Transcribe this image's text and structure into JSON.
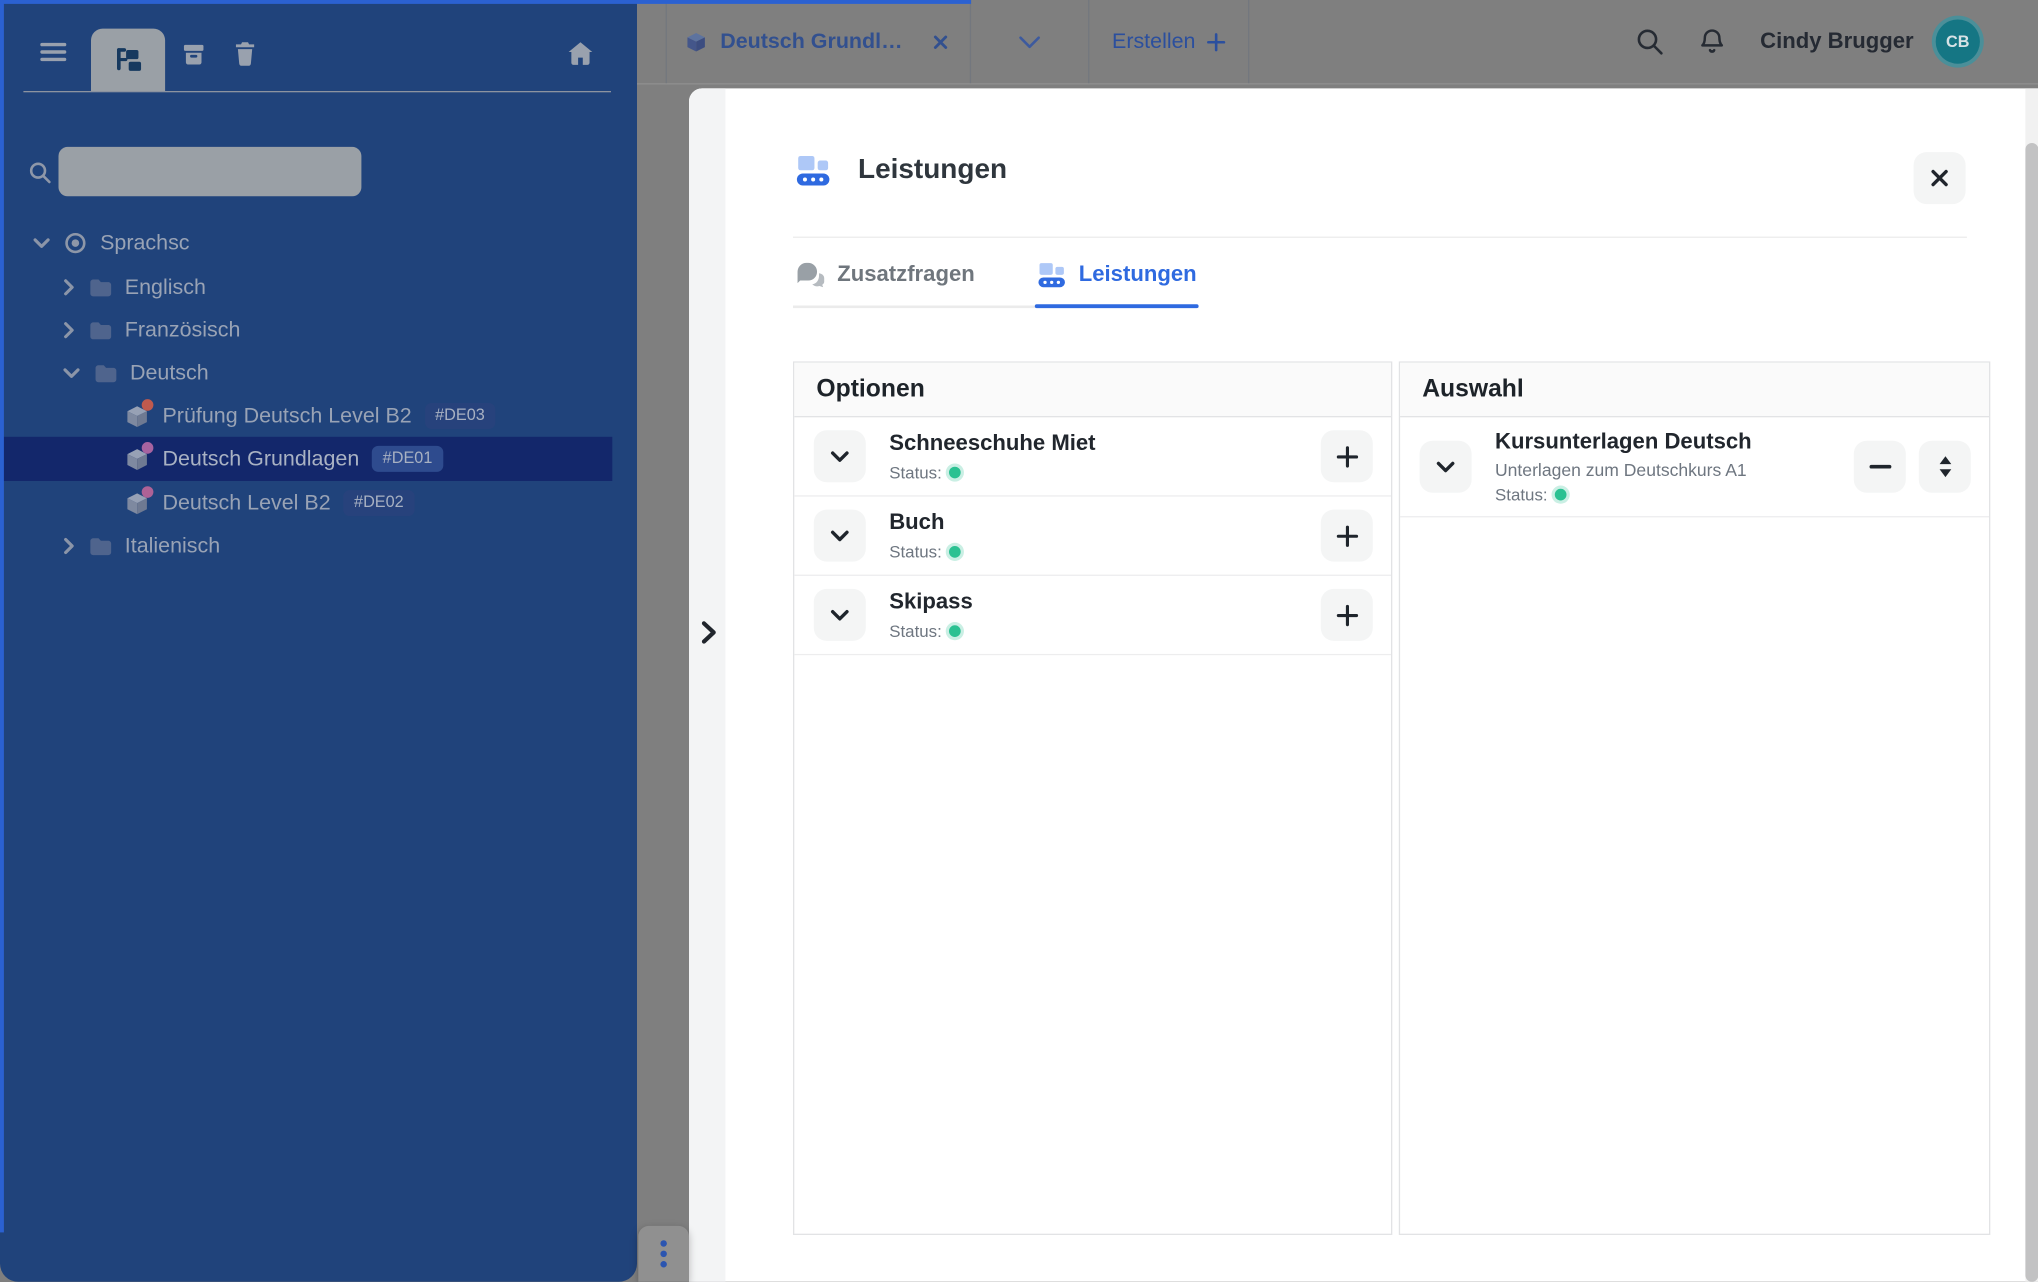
{
  "topbar": {
    "tab": {
      "label": "Deutsch Grundl…"
    },
    "create_label": "Erstellen",
    "user_name": "Cindy Brugger",
    "avatar_initials": "CB"
  },
  "sidebar": {
    "search_placeholder": "",
    "tree": {
      "root_label": "Sprachsc",
      "folders": [
        {
          "label": "Englisch"
        },
        {
          "label": "Französisch"
        },
        {
          "label": "Deutsch"
        },
        {
          "label": "Italienisch"
        }
      ],
      "courses": [
        {
          "label": "Prüfung Deutsch Level B2",
          "code": "#DE03",
          "dot_color": "#bf5a4e"
        },
        {
          "label": "Deutsch Grundlagen",
          "code": "#DE01",
          "dot_color": "#a763a0",
          "selected": true
        },
        {
          "label": "Deutsch Level B2",
          "code": "#DE02",
          "dot_color": "#ae6296"
        }
      ]
    }
  },
  "modal": {
    "title": "Leistungen",
    "tabs": {
      "zusatzfragen": "Zusatzfragen",
      "leistungen": "Leistungen"
    },
    "options": {
      "header": "Optionen",
      "items": [
        {
          "title": "Schneeschuhe Miet",
          "status_label": "Status:",
          "status": "green"
        },
        {
          "title": "Buch",
          "status_label": "Status:",
          "status": "green"
        },
        {
          "title": "Skipass",
          "status_label": "Status:",
          "status": "green"
        }
      ]
    },
    "selection": {
      "header": "Auswahl",
      "items": [
        {
          "title": "Kursunterlagen Deutsch",
          "subtitle": "Unterlagen zum Deutschkurs A1",
          "status_label": "Status:",
          "status": "green"
        }
      ]
    }
  },
  "colors": {
    "sidebar_bg": "#20437b",
    "sidebar_selected_row": "#13276b",
    "frame_blue": "#2b61d1",
    "accent_blue": "#2f6ae0",
    "status_green": "#2bc192",
    "avatar_teal": "#157684",
    "dimmed_backdrop": "#7f7f7f"
  }
}
